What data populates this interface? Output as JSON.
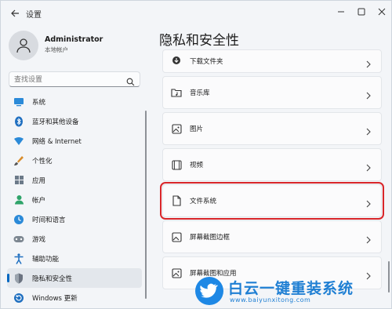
{
  "window": {
    "title": "设置"
  },
  "user": {
    "name": "Administrator",
    "account": "本地帐户"
  },
  "search": {
    "placeholder": "查找设置"
  },
  "sidebar": {
    "items": [
      {
        "label": "系统",
        "icon": "system-icon",
        "active": false
      },
      {
        "label": "蓝牙和其他设备",
        "icon": "bluetooth-icon",
        "active": false
      },
      {
        "label": "网络 & Internet",
        "icon": "network-icon",
        "active": false
      },
      {
        "label": "个性化",
        "icon": "personalize-icon",
        "active": false
      },
      {
        "label": "应用",
        "icon": "apps-icon",
        "active": false
      },
      {
        "label": "帐户",
        "icon": "account-icon",
        "active": false
      },
      {
        "label": "时间和语言",
        "icon": "time-language-icon",
        "active": false
      },
      {
        "label": "游戏",
        "icon": "gaming-icon",
        "active": false
      },
      {
        "label": "辅助功能",
        "icon": "accessibility-icon",
        "active": false
      },
      {
        "label": "隐私和安全性",
        "icon": "privacy-shield-icon",
        "active": true
      },
      {
        "label": "Windows 更新",
        "icon": "windows-update-icon",
        "active": false
      }
    ]
  },
  "main": {
    "title": "隐私和安全性",
    "cards": [
      {
        "label": "下载文件夹",
        "icon": "download-icon"
      },
      {
        "label": "音乐库",
        "icon": "music-folder-icon"
      },
      {
        "label": "图片",
        "icon": "picture-icon"
      },
      {
        "label": "视频",
        "icon": "video-icon"
      },
      {
        "label": "文件系统",
        "icon": "file-icon",
        "highlighted": true
      },
      {
        "label": "屏幕截图边框",
        "icon": "screenshot-border-icon"
      },
      {
        "label": "屏幕截图和应用",
        "icon": "screenshot-apps-icon"
      }
    ]
  },
  "watermark": {
    "title": "白云一键重装系统",
    "url": "www.baiyunxitong.com"
  },
  "colors": {
    "accent": "#0067c0",
    "highlight": "#d9262a",
    "watermark": "#1f7fd3"
  }
}
